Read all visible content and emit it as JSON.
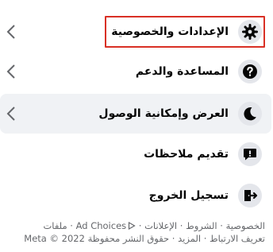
{
  "menu": {
    "items": [
      {
        "label": "الإعدادات والخصوصية",
        "icon": "gear-icon"
      },
      {
        "label": "المساعدة والدعم",
        "icon": "question-icon"
      },
      {
        "label": "العرض وإمكانية الوصول",
        "icon": "moon-icon"
      },
      {
        "label": "تقديم ملاحظات",
        "icon": "feedback-icon"
      },
      {
        "label": "تسجيل الخروج",
        "icon": "logout-icon"
      }
    ]
  },
  "footer": {
    "line1": "الخصوصية · الشروط · الإعلانات · Ad Choices · ملفات",
    "line2": "تعريف الارتباط · المزيد · حقوق النشر محفوظة Meta © 2022",
    "links": {
      "privacy": "الخصوصية",
      "terms": "الشروط",
      "ads": "الإعلانات",
      "ad_choices": "Ad Choices",
      "cookies": "ملفات تعريف الارتباط",
      "more": "المزيد",
      "copyright": "حقوق النشر محفوظة Meta © 2022"
    }
  }
}
